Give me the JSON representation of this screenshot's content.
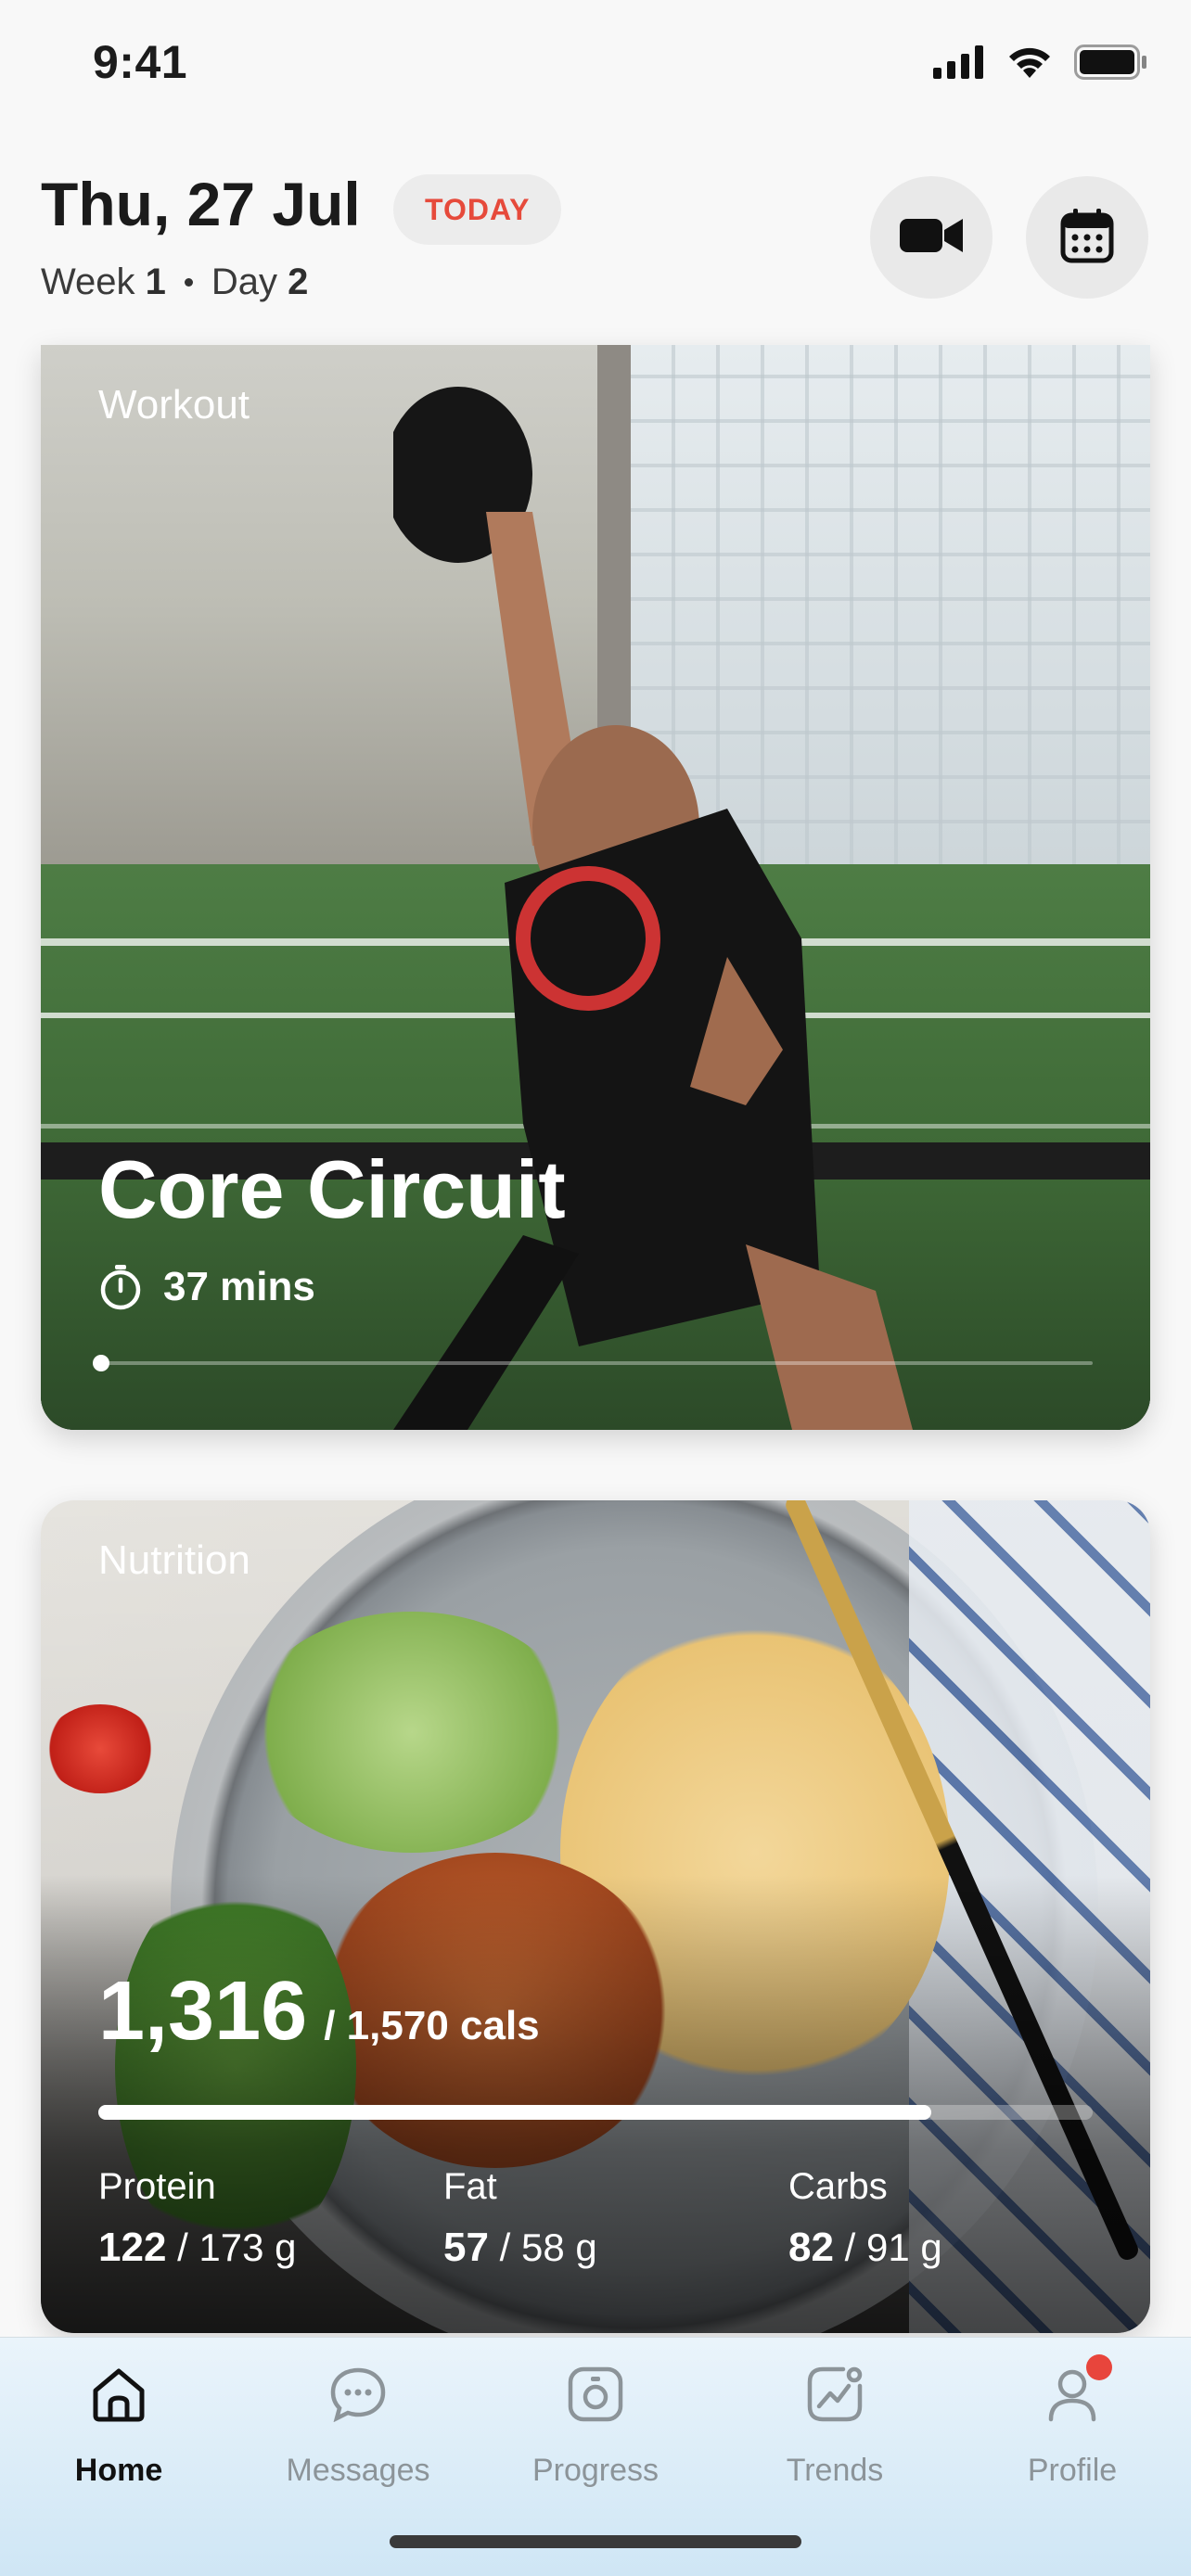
{
  "status_bar": {
    "time": "9:41"
  },
  "header": {
    "date": "Thu, 27 Jul",
    "today_badge": "TODAY",
    "week_label": "Week",
    "week_num": "1",
    "day_label": "Day",
    "day_num": "2"
  },
  "workout": {
    "section_label": "Workout",
    "title": "Core Circuit",
    "duration": "37 mins",
    "progress_fraction": 0.0
  },
  "nutrition": {
    "section_label": "Nutrition",
    "calories_consumed": "1,316",
    "calories_target": "/ 1,570 cals",
    "calories_fraction": 0.838,
    "macros": [
      {
        "label": "Protein",
        "value": "122",
        "target": "/ 173 g"
      },
      {
        "label": "Fat",
        "value": "57",
        "target": "/ 58 g"
      },
      {
        "label": "Carbs",
        "value": "82",
        "target": "/ 91 g"
      }
    ]
  },
  "tabs": [
    {
      "label": "Home",
      "icon": "home-icon",
      "active": true
    },
    {
      "label": "Messages",
      "icon": "chat-bubble-icon",
      "active": false
    },
    {
      "label": "Progress",
      "icon": "scale-icon",
      "active": false
    },
    {
      "label": "Trends",
      "icon": "trend-chart-icon",
      "active": false
    },
    {
      "label": "Profile",
      "icon": "person-icon",
      "active": false,
      "badge": true
    }
  ],
  "colors": {
    "accent_red": "#e64a3b",
    "badge_bg": "#ececec",
    "tab_bar_bg": "#dcecf7"
  }
}
